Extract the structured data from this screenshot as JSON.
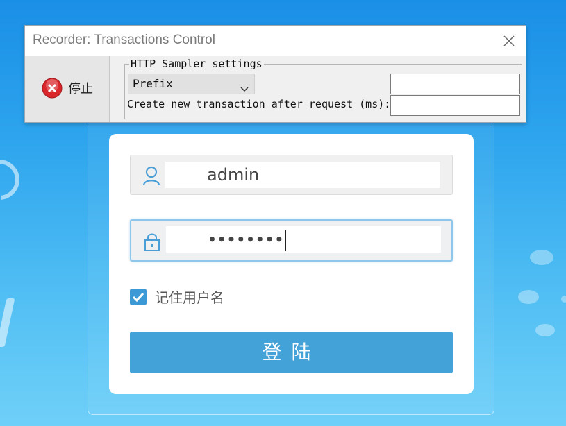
{
  "recorder": {
    "title": "Recorder: Transactions Control",
    "stop_label": "停止",
    "group_label": "HTTP Sampler settings",
    "naming_scheme": {
      "selected": "Prefix"
    },
    "prefix_value": "",
    "create_after_label": "Create new transaction after request (ms):",
    "create_after_value": ""
  },
  "login": {
    "username_value": "admin",
    "password_mask": "••••••••",
    "remember_label": "记住用户名",
    "remember_checked": true,
    "submit_label": "登陆"
  },
  "colors": {
    "background_top": "#1a8fe6",
    "background_bottom": "#6fd0f8",
    "accent": "#43a2d8",
    "checkbox": "#3b9ad6"
  },
  "icons": {
    "username": "user-icon",
    "password": "lock-icon",
    "checkbox": "check-icon",
    "stop": "stop-icon",
    "close": "close-icon",
    "dropdown": "chevron-down-icon"
  }
}
